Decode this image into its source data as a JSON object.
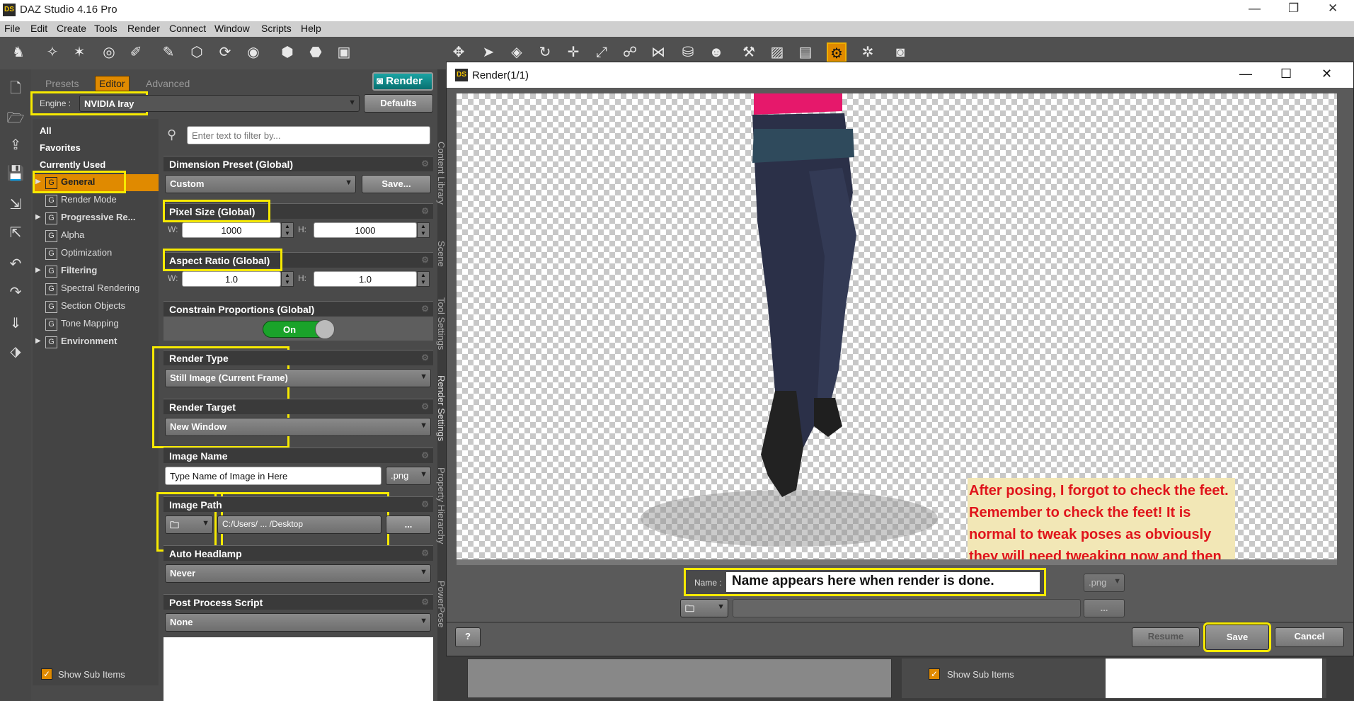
{
  "app": {
    "title": "DAZ Studio 4.16 Pro",
    "logo": "DS"
  },
  "menu": [
    "File",
    "Edit",
    "Create",
    "Tools",
    "Render",
    "Connect",
    "Window",
    "Scripts",
    "Help"
  ],
  "panel": {
    "tabs": [
      "Presets",
      "Editor",
      "Advanced"
    ],
    "render_button": "Render",
    "engine_label": "Engine :",
    "engine_value": "NVIDIA Iray",
    "defaults_button": "Defaults",
    "filter_placeholder": "Enter text to filter by...",
    "nav": [
      {
        "label": "All"
      },
      {
        "label": "Favorites"
      },
      {
        "label": "Currently Used"
      },
      {
        "label": "General"
      },
      {
        "label": "Render Mode"
      },
      {
        "label": "Progressive Re..."
      },
      {
        "label": "Alpha"
      },
      {
        "label": "Optimization"
      },
      {
        "label": "Filtering"
      },
      {
        "label": "Spectral Rendering"
      },
      {
        "label": "Section Objects"
      },
      {
        "label": "Tone Mapping"
      },
      {
        "label": "Environment"
      }
    ],
    "group_icon_letter": "G",
    "show_sub_items": "Show Sub Items",
    "sections": {
      "dimension_preset": {
        "title": "Dimension Preset (Global)",
        "value": "Custom",
        "button": "Save..."
      },
      "pixel_size": {
        "title": "Pixel Size (Global)",
        "w_label": "W:",
        "w": "1000",
        "h_label": "H:",
        "h": "1000"
      },
      "aspect_ratio": {
        "title": "Aspect Ratio (Global)",
        "w_label": "W:",
        "w": "1.0",
        "h_label": "H:",
        "h": "1.0"
      },
      "constrain": {
        "title": "Constrain Proportions (Global)",
        "toggle": "On"
      },
      "render_type": {
        "title": "Render Type",
        "value": "Still Image (Current Frame)"
      },
      "render_target": {
        "title": "Render Target",
        "value": "New Window"
      },
      "image_name": {
        "title": "Image Name",
        "value": "Type Name of Image in Here",
        "ext": ".png"
      },
      "image_path": {
        "title": "Image Path",
        "value": "C:/Users/    ...    /Desktop",
        "browse": "..."
      },
      "auto_headlamp": {
        "title": "Auto Headlamp",
        "value": "Never"
      },
      "post_process": {
        "title": "Post Process Script",
        "value": "None"
      }
    },
    "side_tabs": [
      "Content Library",
      "Scene",
      "Tool Settings",
      "Render Settings",
      "Property Hierarchy",
      "PowerPose"
    ]
  },
  "render_window": {
    "title": "Render(1/1)",
    "note": "After posing, I forgot to check the feet. Remember to check the feet! It is normal to tweak poses as obviously they will need tweaking now and then ;-)",
    "name_label": "Name :",
    "name_value": "Name appears here when render is done.",
    "ext": ".png",
    "browse": "...",
    "resume": "Resume",
    "save": "Save",
    "cancel": "Cancel",
    "help_icon": "?"
  },
  "bottom_right": {
    "show_sub_items": "Show Sub Items"
  },
  "colors": {
    "accent": "#f7ea00",
    "orange": "#e08a00",
    "note_text": "#e0141b",
    "note_bg": "#f2e7b6"
  }
}
